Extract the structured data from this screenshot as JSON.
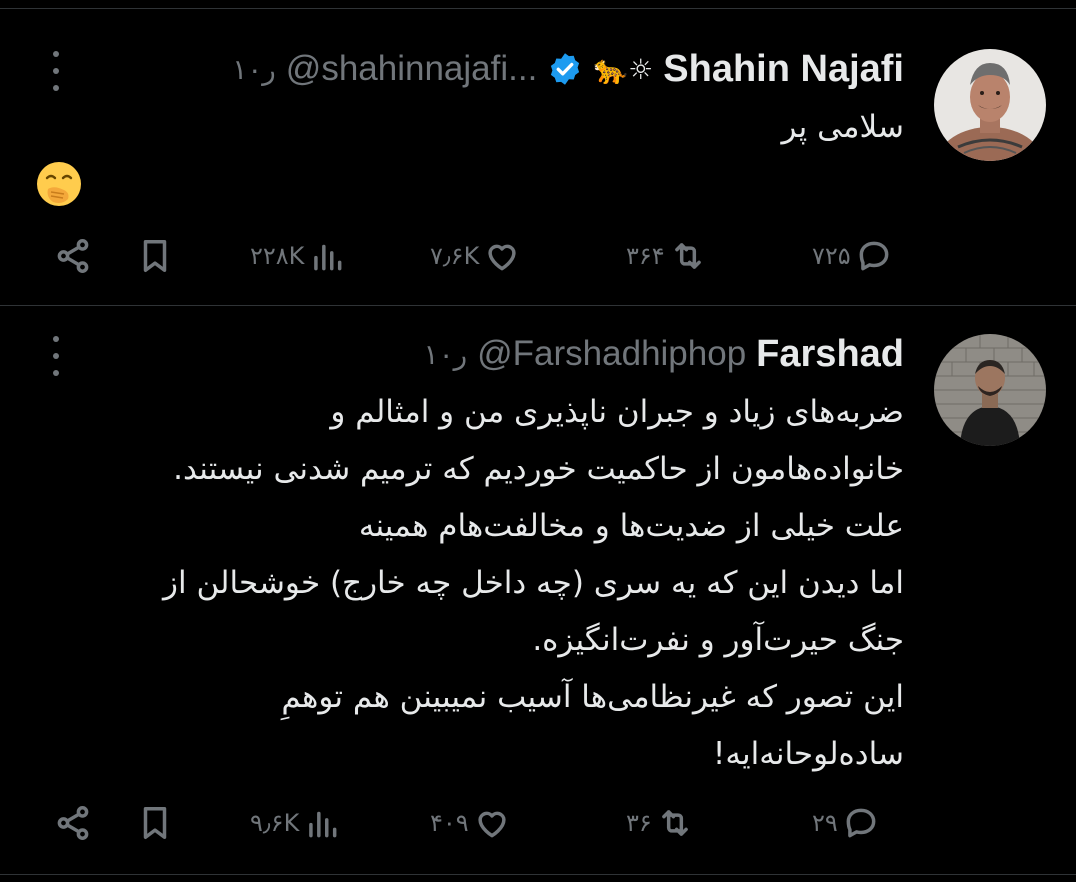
{
  "tweets": [
    {
      "display_name": "Shahin Najafi",
      "name_emoji": "🐆☼",
      "verified": true,
      "handle": "@shahinnajafi...",
      "time": "۱۰ر",
      "text": "سلامی پر",
      "emoji": "🤭",
      "stats": {
        "replies": "۷۲۵",
        "retweets": "۳۶۴",
        "likes": "۷٫۶K",
        "views": "۲۲۸K"
      },
      "avatar_icon": "avatar-photo-shahin"
    },
    {
      "display_name": "Farshad",
      "verified": false,
      "handle": "@Farshadhiphop",
      "time": "۱۰ر",
      "text": "ضربه‌های زیاد و جبران ناپذیری من و امثالم و\nخانواده‌هامون از حاکمیت خوردیم که ترمیم شدنی نیستند.\nعلت خیلی از ضدیت‌ها و مخالفت‌هام همینه\nاما دیدن این که یه سری (چه داخل چه خارج) خوشحالن از\nجنگ حیرت‌آور و نفرت‌انگیزه.\nاین تصور که غیرنظامی‌ها آسیب نمیبینن هم توهمِ\nساده‌لوحانه‌ایه!",
      "stats": {
        "replies": "۲۹",
        "retweets": "۳۶",
        "likes": "۴۰۹",
        "views": "۹٫۶K"
      },
      "avatar_icon": "avatar-photo-farshad"
    }
  ],
  "colors": {
    "background": "#000000",
    "primary_text": "#e7e9ea",
    "secondary_text": "#71767b",
    "divider": "#2f3336",
    "verified_blue": "#1d9bf0"
  },
  "icons": [
    "more-icon",
    "verified-badge-icon",
    "reply-icon",
    "retweet-icon",
    "like-icon",
    "views-icon",
    "bookmark-icon",
    "share-icon"
  ]
}
